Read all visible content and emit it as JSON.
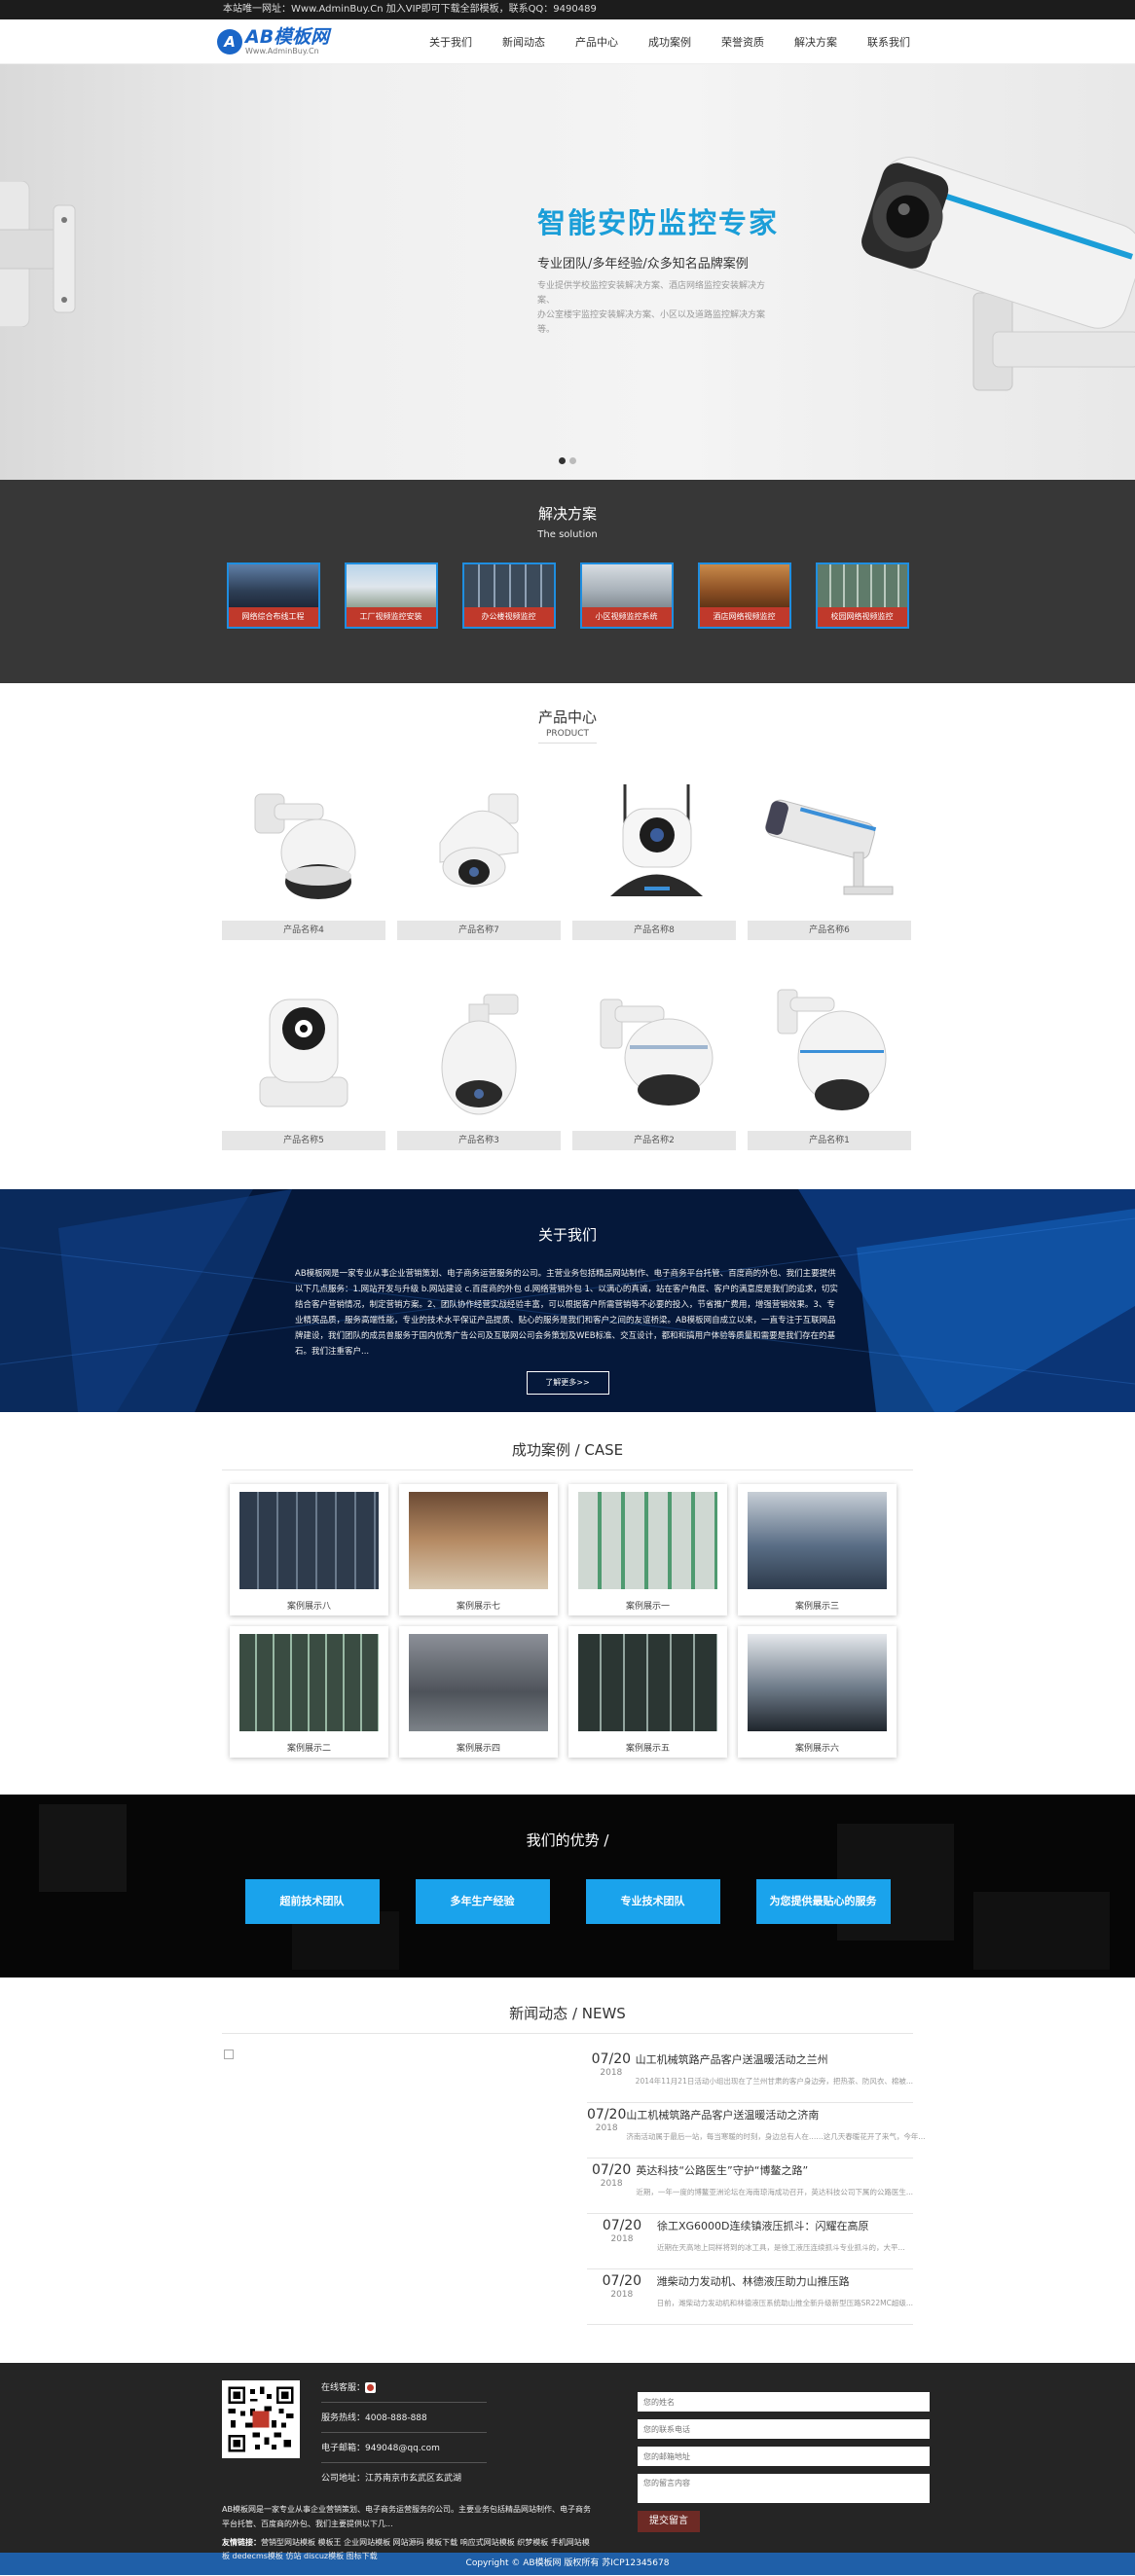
{
  "topbar": {
    "text": "本站唯一网址：Www.AdminBuy.Cn 加入VIP即可下载全部模板，联系QQ：9490489"
  },
  "logo": {
    "mark": "A",
    "name": "AB模板网",
    "url": "Www.AdminBuy.Cn"
  },
  "nav": [
    "关于我们",
    "新闻动态",
    "产品中心",
    "成功案例",
    "荣誉资质",
    "解决方案",
    "联系我们"
  ],
  "banner": {
    "title": "智能安防监控专家",
    "subtitle": "专业团队/多年经验/众多知名品牌案例",
    "desc1": "专业提供学校监控安装解决方案、酒店网络监控安装解决方案、",
    "desc2": "办公室楼宇监控安装解决方案、小区以及道路监控解决方案等。"
  },
  "solutions": {
    "title": "解决方案",
    "subtitle": "The solution",
    "items": [
      "网络综合布线工程",
      "工厂视频监控安装",
      "办公楼视频监控",
      "小区视频监控系统",
      "酒店网络视频监控",
      "校园网络视频监控"
    ]
  },
  "products": {
    "title": "产品中心",
    "subtitle": "PRODUCT",
    "items": [
      "产品名称4",
      "产品名称7",
      "产品名称8",
      "产品名称6",
      "产品名称5",
      "产品名称3",
      "产品名称2",
      "产品名称1"
    ]
  },
  "about": {
    "title": "关于我们",
    "text": "AB模板网是一家专业从事企业营销策划、电子商务运营服务的公司。主营业务包括精品网站制作、电子商务平台托管、百度商的外包、我们主要提供以下几点服务：1.网站开发与升级 b.网站建设 c.百度商的外包 d.网络营销外包 1、以满心的真诚，站在客户角度、客户的满意度是我们的追求，切实结合客户营销情况，制定营销方案。2、团队协作经营实战经验丰富，可以根据客户所需营销等不必要的投入，节省推广费用，增强营销效果。3、专业精英品质，服务高端性能，专业的技术水平保证产品提质、贴心的服务是我们和客户之间的友谊桥梁。AB模板网自成立以来，一直专注于互联网品牌建设，我们团队的成员曾服务于国内优秀广告公司及互联网公司会务策划及WEB标准、交互设计，都和和搞用户体验等质量和需要是我们存在的基石。我们注重客户...",
    "button": "了解更多>>"
  },
  "cases": {
    "title": "成功案例 / CASE",
    "items": [
      "案例展示八",
      "案例展示七",
      "案例展示一",
      "案例展示三",
      "案例展示二",
      "案例展示四",
      "案例展示五",
      "案例展示六"
    ]
  },
  "advantages": {
    "title": "我们的优势 /",
    "items": [
      "超前技术团队",
      "多年生产经验",
      "专业技术团队",
      "为您提供最贴心的服务"
    ]
  },
  "news": {
    "title": "新闻动态 / NEWS",
    "items": [
      {
        "day": "07/20",
        "year": "2018",
        "title": "山工机械筑路产品客户送温暖活动之兰州",
        "summary": "2014年11月21日活动小组出现在了兰州甘肃的客户身边旁，把热茶、防风衣、棉被..."
      },
      {
        "day": "07/20",
        "year": "2018",
        "title": "山工机械筑路产品客户送温暖活动之济南",
        "summary": "济南活动属于最后一站，每当寒暖的时刻，身边总有人在……这几天春暖花开了来气，今年..."
      },
      {
        "day": "07/20",
        "year": "2018",
        "title": "英达科技“公路医生”守护“博鳌之路”",
        "summary": "近期，一年一度的博鳌亚洲论坛在海南琼海成功召开，英达科技公司下属的公路医生..."
      },
      {
        "day": "07/20",
        "year": "2018",
        "title": "徐工XG6000D连续镇液压抓斗：闪耀在高原",
        "summary": "近期在天高地上同样将到的冰工具，是徐工液压连续抓斗专业抓斗的，大平..."
      },
      {
        "day": "07/20",
        "year": "2018",
        "title": "潍柴动力发动机、林德液压助力山推压路",
        "summary": "日前，潍柴动力发动机和林德液压系统助山推全新升级新型压路SR22MC超级..."
      }
    ]
  },
  "footer": {
    "online": "在线客服：",
    "phone": "服务热线：4008-888-888",
    "email": "电子邮箱：949048@qq.com",
    "address": "公司地址：江苏南京市玄武区玄武湖",
    "desc": "AB模板网是一家专业从事企业营销策划、电子商务运营服务的公司。主要业务包括精品网站制作、电子商务平台托管、百度商的外包、我们主要提供以下几...",
    "links_label": "友情链接：",
    "links": "营销型网站模板 模板王 企业网站模板 网站源码 模板下载 响应式网站模板 织梦模板 手机网站模板 dedecms模板 仿站 discuz模板 图标下载",
    "form": {
      "name_placeholder": "您的姓名",
      "contact_placeholder": "您的联系电话",
      "email_placeholder": "您的邮箱地址",
      "message_placeholder": "您的留言内容",
      "submit": "提交留言"
    },
    "copyright": "Copyright © AB模板网 版权所有  苏ICP12345678"
  },
  "colors": {
    "accent": "#1b9ed8",
    "solution_label": "#c0392b",
    "advantage_button": "#1aa3ec",
    "copyright_bar": "#1f5fa8"
  }
}
